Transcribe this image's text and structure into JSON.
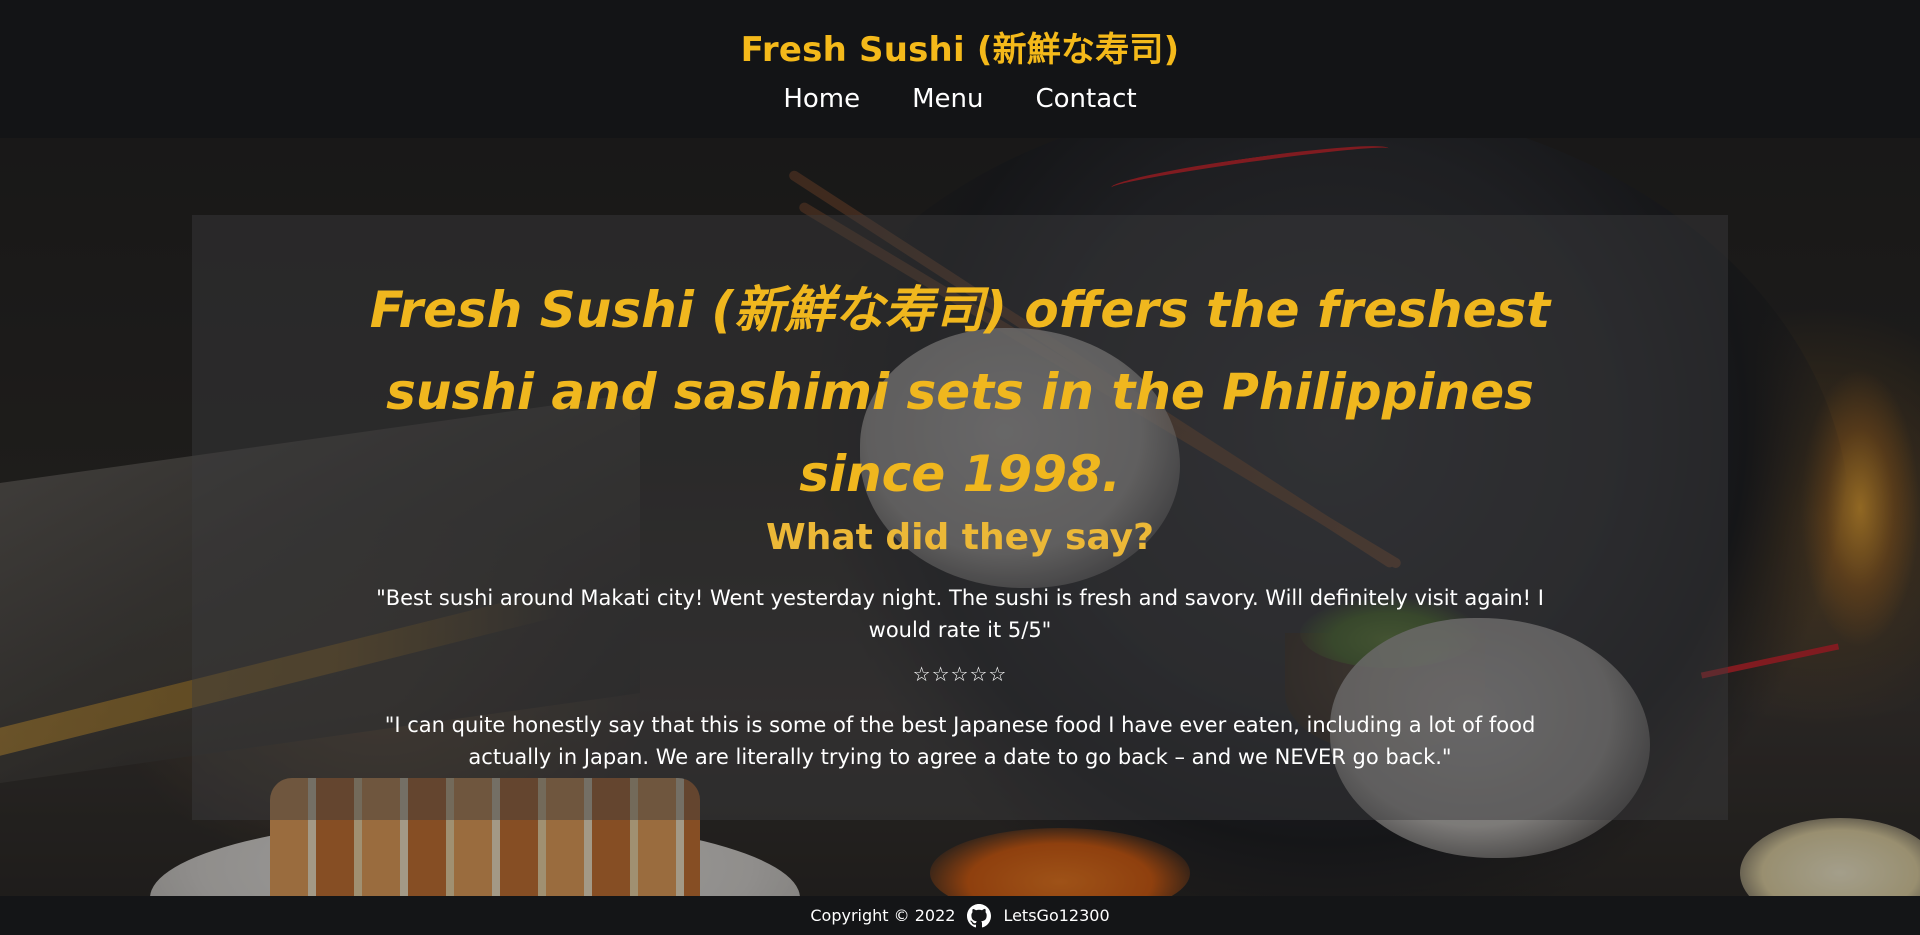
{
  "header": {
    "brand": "Fresh Sushi (新鮮な寿司)",
    "nav": {
      "home": "Home",
      "menu": "Menu",
      "contact": "Contact"
    }
  },
  "hero": {
    "tagline": "Fresh Sushi (新鮮な寿司) offers the freshest sushi and sashimi sets in the Philippines since 1998.",
    "reviews_heading": "What did they say?",
    "reviews": [
      {
        "text": "\"Best sushi around Makati city! Went yesterday night. The sushi is fresh and savory. Will definitely visit again! I would rate it 5/5\"",
        "stars": "☆☆☆☆☆"
      },
      {
        "text": "\"I can quite honestly say that this is some of the best Japanese food I have ever eaten, including a lot of food actually in Japan. We are literally trying to agree a date to go back – and we NEVER go back.\""
      }
    ]
  },
  "footer": {
    "copyright": "Copyright © 2022",
    "github_icon": "github-icon",
    "github_user": "LetsGo12300"
  },
  "colors": {
    "accent": "#f0b71e",
    "heading_accent": "#ecb837",
    "header_bg": "#131416"
  }
}
